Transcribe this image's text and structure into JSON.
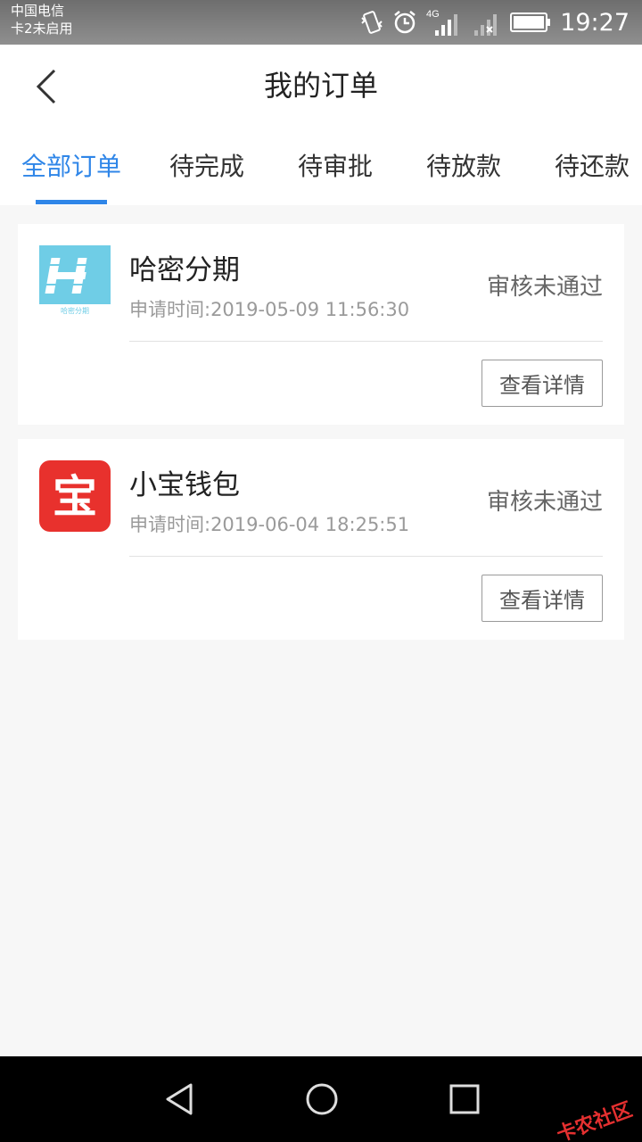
{
  "status_bar": {
    "carrier_line1": "中国电信",
    "carrier_line2": "卡2未启用",
    "network": "4G",
    "time": "19:27"
  },
  "header": {
    "title": "我的订单",
    "back_icon": "chevron-left-icon"
  },
  "tabs": [
    {
      "label": "全部订单",
      "active": true
    },
    {
      "label": "待完成",
      "active": false
    },
    {
      "label": "待审批",
      "active": false
    },
    {
      "label": "待放款",
      "active": false
    },
    {
      "label": "待还款",
      "active": false
    }
  ],
  "orders": [
    {
      "name": "哈密分期",
      "logo_caption": "哈密分期",
      "apply_time": "申请时间:2019-05-09 11:56:30",
      "status": "审核未通过",
      "button": "查看详情"
    },
    {
      "name": "小宝钱包",
      "logo_text": "宝",
      "apply_time": "申请时间:2019-06-04 18:25:51",
      "status": "审核未通过",
      "button": "查看详情"
    }
  ],
  "watermark": "卡农社区",
  "colors": {
    "accent": "#2f86e8",
    "hami_logo": "#6fcde6",
    "xiaobao_logo": "#e8312d"
  }
}
